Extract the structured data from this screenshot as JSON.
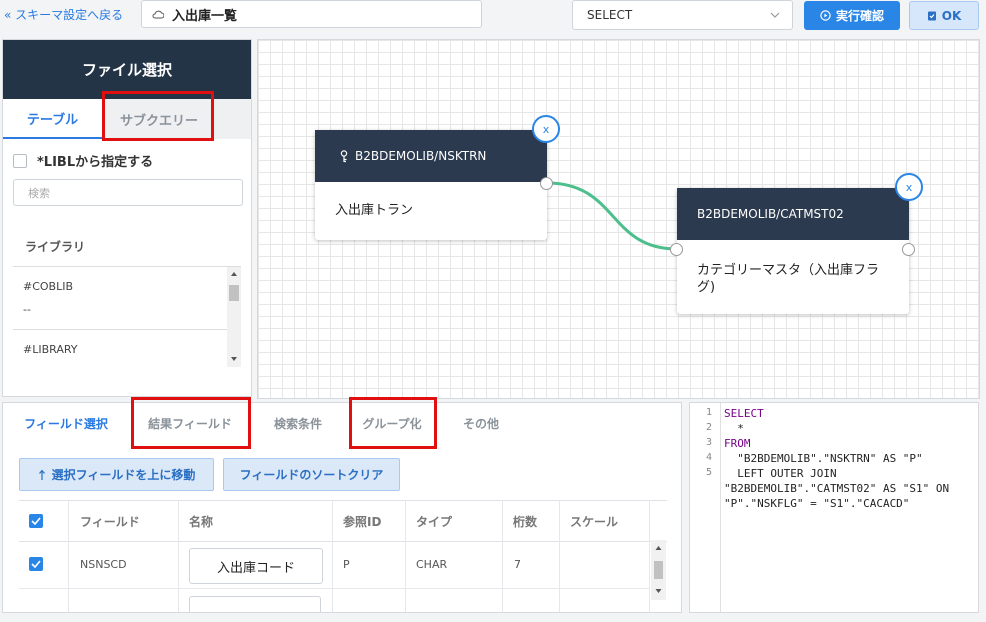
{
  "header": {
    "back_link": "« スキーマ設定へ戻る",
    "title": "入出庫一覧",
    "select_value": "SELECT",
    "run_button": "実行確認",
    "ok_button": "OK"
  },
  "sidebar": {
    "title": "ファイル選択",
    "tabs": [
      "テーブル",
      "サブクエリー"
    ],
    "libl_label": "*LIBLから指定する",
    "search_placeholder": "検索",
    "library_label": "ライブラリ",
    "libraries": [
      {
        "name": "#COBLIB",
        "desc": "--"
      },
      {
        "name": "#LIBRARY",
        "desc": ""
      }
    ]
  },
  "canvas": {
    "nodes": [
      {
        "title": "B2BDEMOLIB/NSKTRN",
        "body": "入出庫トラン",
        "close": "x"
      },
      {
        "title": "B2BDEMOLIB/CATMST02",
        "body": "カテゴリーマスタ（入出庫フラグ)",
        "close": "x"
      }
    ]
  },
  "fields": {
    "tabs": [
      "フィールド選択",
      "結果フィールド",
      "検索条件",
      "グループ化",
      "その他"
    ],
    "move_up_button": "選択フィールドを上に移動",
    "sort_clear_button": "フィールドのソートクリア",
    "columns": [
      "フィールド",
      "名称",
      "参照ID",
      "タイプ",
      "桁数",
      "スケール"
    ],
    "rows": [
      {
        "field": "NSNSCD",
        "name": "入出庫コード",
        "ref": "P",
        "type": "CHAR",
        "digits": "7",
        "scale": ""
      }
    ]
  },
  "sql": {
    "line_numbers": [
      "1",
      "2",
      "3",
      "4",
      "5"
    ],
    "lines": [
      {
        "kw": "SELECT",
        "text": ""
      },
      {
        "kw": "",
        "text": "  *"
      },
      {
        "kw": "FROM",
        "text": ""
      },
      {
        "kw": "",
        "text": "  \"B2BDEMOLIB\".\"NSKTRN\" AS \"P\""
      },
      {
        "kw": "",
        "text": "  LEFT OUTER JOIN"
      },
      {
        "kw": "",
        "text": "\"B2BDEMOLIB\".\"CATMST02\" AS \"S1\" ON"
      },
      {
        "kw": "",
        "text": "\"P\".\"NSKFLG\" = \"S1\".\"CACACD\""
      }
    ]
  },
  "colors": {
    "accent": "#2a86e6",
    "node_header": "#2b3a4e",
    "sidebar_header": "#243447",
    "connector": "#4dbf8c",
    "highlight": "#e01010"
  }
}
